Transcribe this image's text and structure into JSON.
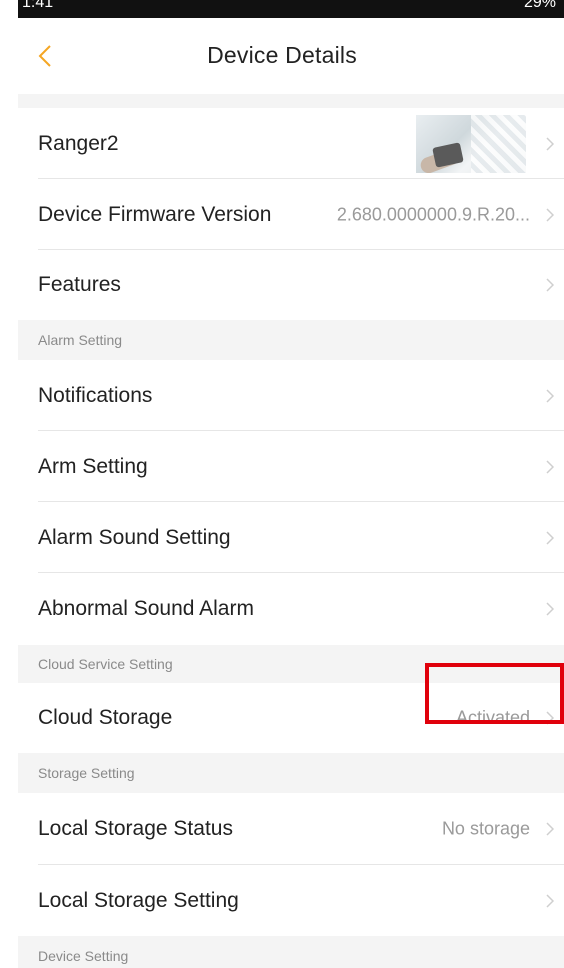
{
  "status_bar": {
    "left": "1:41",
    "right": "29%"
  },
  "nav": {
    "title": "Device Details",
    "back_icon": "chevron-left-icon",
    "accent": "#f5a623"
  },
  "rows": {
    "device_name": {
      "label": "Ranger2"
    },
    "firmware": {
      "label": "Device Firmware Version",
      "value": "2.680.0000000.9.R.20..."
    },
    "features": {
      "label": "Features"
    },
    "notifications": {
      "label": "Notifications"
    },
    "arm_setting": {
      "label": "Arm Setting"
    },
    "alarm_sound": {
      "label": "Alarm Sound Setting"
    },
    "abnormal_sound": {
      "label": "Abnormal Sound Alarm"
    },
    "cloud_storage": {
      "label": "Cloud Storage",
      "value": "Activated"
    },
    "local_status": {
      "label": "Local Storage Status",
      "value": "No storage"
    },
    "local_setting": {
      "label": "Local Storage Setting"
    }
  },
  "sections": {
    "alarm": "Alarm Setting",
    "cloud": "Cloud Service Setting",
    "storage": "Storage Setting",
    "device": "Device Setting"
  },
  "colors": {
    "highlight": "#e0000b",
    "section_bg": "#f4f4f4",
    "secondary_text": "#9a9a9a"
  }
}
